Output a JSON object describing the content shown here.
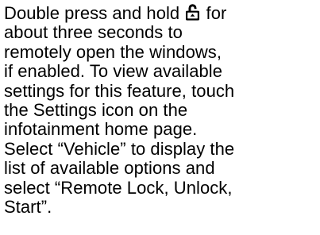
{
  "paragraph": {
    "line1_before_icon": "Double press and hold ",
    "icon": "unlock-icon",
    "line1_after_icon": " for",
    "lines": [
      "about three seconds to",
      "remotely open the windows,",
      "if enabled. To view available",
      "settings for this feature, touch",
      "the Settings icon on the",
      "infotainment home page.",
      "Select “Vehicle” to display the",
      "list of available options and",
      "select “Remote Lock, Unlock,",
      "Start”."
    ]
  }
}
